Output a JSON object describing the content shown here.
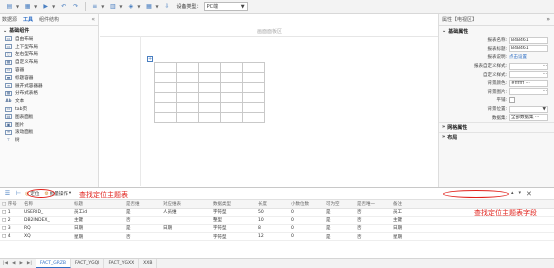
{
  "toolbar": {
    "device_label": "设备类型：",
    "device_value": "PC端"
  },
  "left_panel": {
    "tabs": [
      "数据源",
      "工具",
      "组件结构"
    ],
    "section": "基础组件",
    "items": [
      {
        "label": "自由布局",
        "icon": "▭"
      },
      {
        "label": "上下型布局",
        "icon": "▭"
      },
      {
        "label": "左右型布局",
        "icon": "▯"
      },
      {
        "label": "自定义布局",
        "icon": "▦"
      },
      {
        "label": "容器",
        "icon": "▭"
      },
      {
        "label": "标题容器",
        "icon": "▬"
      },
      {
        "label": "展开式容器器",
        "icon": "≡"
      },
      {
        "label": "分布式表格",
        "icon": "▦"
      },
      {
        "label": "文本",
        "icon": "Ab"
      },
      {
        "label": "tab页",
        "icon": "▭"
      },
      {
        "label": "图表面板",
        "icon": "▤"
      },
      {
        "label": "图片",
        "icon": "▣"
      },
      {
        "label": "滚动面板",
        "icon": "≡"
      },
      {
        "label": "树",
        "icon": "⊤"
      }
    ]
  },
  "canvas": {
    "title": "画面面板区",
    "anchor_icon": "+"
  },
  "right_panel": {
    "title": "属性【电视区】",
    "section": "基础属性",
    "props": [
      {
        "label": "报表名称:",
        "value": "B4B461",
        "kind": "input"
      },
      {
        "label": "报表标题:",
        "value": "B4B461",
        "kind": "input"
      },
      {
        "label": "报表说明:",
        "value": "点击设置",
        "kind": "link"
      },
      {
        "label": "报表自定义样式:",
        "value": "",
        "kind": "dots"
      },
      {
        "label": "自定义样式:",
        "value": "",
        "kind": "dots"
      },
      {
        "label": "背景颜色:",
        "value": "#ffffff",
        "kind": "dots"
      },
      {
        "label": "背景图片:",
        "value": "",
        "kind": "dots"
      },
      {
        "label": "平铺:",
        "value": "",
        "kind": "check"
      },
      {
        "label": "背景位置:",
        "value": "",
        "kind": "select"
      },
      {
        "label": "数据集:",
        "value": "全部数据集",
        "kind": "dots"
      }
    ],
    "folds": [
      "网格属性",
      "布局"
    ]
  },
  "bottom": {
    "buttons": {
      "locate": "定位",
      "batch": "批量操作"
    },
    "annotation_left": "查找定位主题表",
    "annotation_right": "查找定位主题表字段",
    "columns": [
      "序号",
      "名称",
      "标题",
      "是否维",
      "对应维表",
      "数据类型",
      "长度",
      "小数位数",
      "可为空",
      "是否唯一",
      "备注"
    ],
    "rows": [
      [
        "1",
        "USERID_",
        "员工id",
        "是",
        "人员维",
        "字符型",
        "50",
        "0",
        "是",
        "否",
        "员工"
      ],
      [
        "2",
        "DB2INDEX_",
        "主键",
        "否",
        "",
        "整型",
        "10",
        "0",
        "是",
        "否",
        "主键"
      ],
      [
        "3",
        "RQ",
        "日期",
        "是",
        "日期",
        "字符型",
        "8",
        "0",
        "是",
        "否",
        "日期"
      ],
      [
        "4",
        "XQ",
        "星期",
        "否",
        "",
        "字符型",
        "12",
        "0",
        "是",
        "否",
        "星期"
      ]
    ],
    "tabs": [
      "FACT_GRZB",
      "FACT_YGQI",
      "FACT_YGXX",
      "XXB"
    ]
  }
}
